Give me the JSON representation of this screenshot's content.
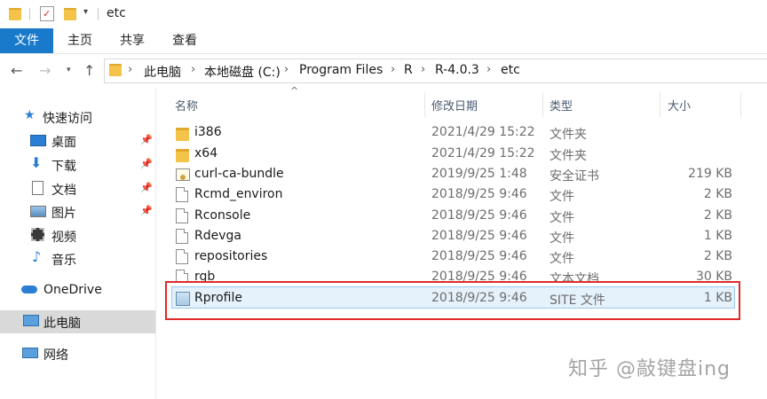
{
  "window": {
    "title": "etc"
  },
  "ribbon": {
    "tabs": [
      "文件",
      "主页",
      "共享",
      "查看"
    ]
  },
  "address": {
    "crumbs": [
      "此电脑",
      "本地磁盘 (C:)",
      "Program Files",
      "R",
      "R-4.0.3",
      "etc"
    ]
  },
  "sidebar": {
    "quick_access": "快速访问",
    "items": [
      {
        "label": "桌面",
        "icon": "desktop-icon"
      },
      {
        "label": "下载",
        "icon": "download-icon"
      },
      {
        "label": "文档",
        "icon": "document-icon"
      },
      {
        "label": "图片",
        "icon": "picture-icon"
      },
      {
        "label": "视频",
        "icon": "video-icon"
      },
      {
        "label": "音乐",
        "icon": "music-icon"
      }
    ],
    "onedrive": "OneDrive",
    "thispc": "此电脑",
    "network": "网络"
  },
  "columns": {
    "name": "名称",
    "modified": "修改日期",
    "type": "类型",
    "size": "大小"
  },
  "files": [
    {
      "name": "i386",
      "modified": "2021/4/29 15:22",
      "type": "文件夹",
      "size": "",
      "icon": "folder"
    },
    {
      "name": "x64",
      "modified": "2021/4/29 15:22",
      "type": "文件夹",
      "size": "",
      "icon": "folder"
    },
    {
      "name": "curl-ca-bundle",
      "modified": "2019/9/25 1:48",
      "type": "安全证书",
      "size": "219 KB",
      "icon": "cert"
    },
    {
      "name": "Rcmd_environ",
      "modified": "2018/9/25 9:46",
      "type": "文件",
      "size": "2 KB",
      "icon": "doc"
    },
    {
      "name": "Rconsole",
      "modified": "2018/9/25 9:46",
      "type": "文件",
      "size": "2 KB",
      "icon": "doc"
    },
    {
      "name": "Rdevga",
      "modified": "2018/9/25 9:46",
      "type": "文件",
      "size": "1 KB",
      "icon": "doc"
    },
    {
      "name": "repositories",
      "modified": "2018/9/25 9:46",
      "type": "文件",
      "size": "2 KB",
      "icon": "doc"
    },
    {
      "name": "rgb",
      "modified": "2018/9/25 9:46",
      "type": "文本文档",
      "size": "30 KB",
      "icon": "doc"
    },
    {
      "name": "Rprofile",
      "modified": "2018/9/25 9:46",
      "type": "SITE 文件",
      "size": "1 KB",
      "icon": "site"
    }
  ],
  "watermark": "知乎 @敲键盘ing",
  "colors": {
    "accent": "#1979ca",
    "highlight": "#e02a2a",
    "selected": "#e5f1fb"
  }
}
